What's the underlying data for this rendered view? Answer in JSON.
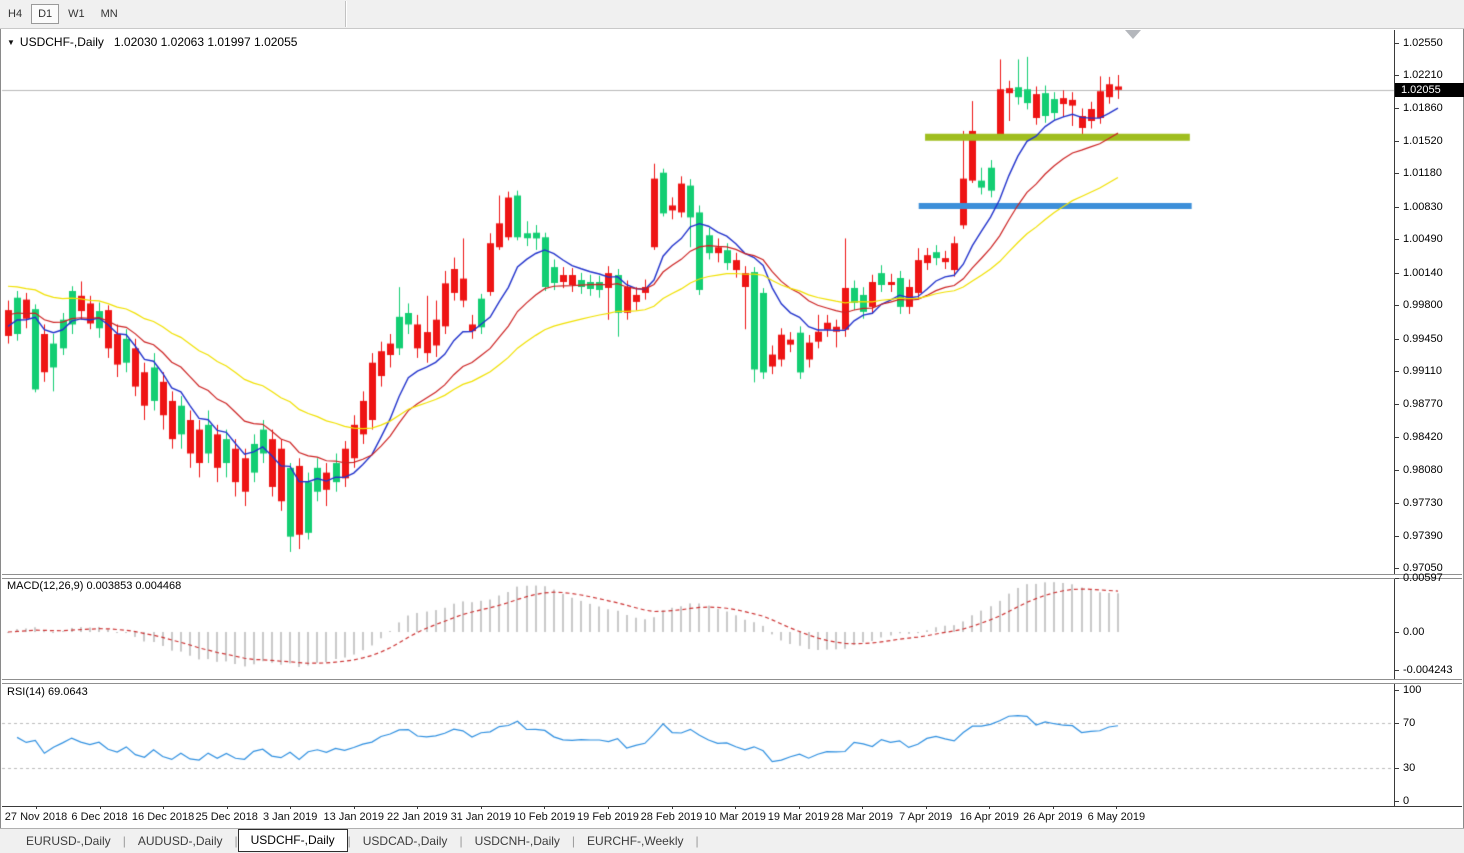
{
  "toolbar": {
    "timeframes": [
      {
        "label": "H4",
        "active": false
      },
      {
        "label": "D1",
        "active": true
      },
      {
        "label": "W1",
        "active": false
      },
      {
        "label": "MN",
        "active": false
      }
    ]
  },
  "quote": {
    "collapse_icon": "▼",
    "symbol": "USDCHF-,Daily",
    "ohlc": "1.02030 1.02063 1.01997 1.02055"
  },
  "panes": {
    "macd_label": "MACD(12,26,9) 0.003853 0.004468",
    "rsi_label": "RSI(14) 69.0643"
  },
  "price_axis": {
    "labels": [
      "1.02550",
      "1.02210",
      "1.01860",
      "1.01520",
      "1.01180",
      "1.00830",
      "1.00490",
      "1.00140",
      "0.99800",
      "0.99450",
      "0.99110",
      "0.98770",
      "0.98420",
      "0.98080",
      "0.97730",
      "0.97390",
      "0.97050"
    ],
    "current": "1.02055"
  },
  "macd_axis": [
    {
      "label": "0.00597",
      "value": 0.00597
    },
    {
      "label": "0.00",
      "value": 0
    },
    {
      "label": "-0.004243",
      "value": -0.004243
    }
  ],
  "rsi_axis": [
    {
      "label": "100",
      "value": 100
    },
    {
      "label": "70",
      "value": 70
    },
    {
      "label": "30",
      "value": 30
    },
    {
      "label": "0",
      "value": 0
    }
  ],
  "date_axis": [
    "27 Nov 2018",
    "6 Dec 2018",
    "16 Dec 2018",
    "25 Dec 2018",
    "3 Jan 2019",
    "13 Jan 2019",
    "22 Jan 2019",
    "31 Jan 2019",
    "10 Feb 2019",
    "19 Feb 2019",
    "28 Feb 2019",
    "10 Mar 2019",
    "19 Mar 2019",
    "28 Mar 2019",
    "7 Apr 2019",
    "16 Apr 2019",
    "26 Apr 2019",
    "6 May 2019"
  ],
  "tabs": [
    {
      "label": "EURUSD-,Daily",
      "active": false
    },
    {
      "label": "AUDUSD-,Daily",
      "active": false
    },
    {
      "label": "USDCHF-,Daily",
      "active": true
    },
    {
      "label": "USDCAD-,Daily",
      "active": false
    },
    {
      "label": "USDCNH-,Daily",
      "active": false
    },
    {
      "label": "EURCHF-,Weekly",
      "active": false
    }
  ],
  "tab_separator": "|",
  "colors": {
    "background": "#FFFFFF",
    "chrome": "#F0F0F0",
    "bull": "#13CE73",
    "bear": "#EE1414",
    "ma_fast": "#2233CC",
    "ma_mid": "#CC2222",
    "ma_slow": "#F0E000",
    "macd_hist": "#C9C9C9",
    "macd_signal": "#CC3333",
    "rsi_line": "#2E8FE0",
    "grid_dash": "#BBBBBB",
    "bid_line": "#B9B9B9",
    "axis_text": "#000000",
    "current_tag_bg": "#000000",
    "current_tag_text": "#FFFFFF",
    "hline_olive": "#9FBE1E",
    "hline_blue": "#3C8FD9"
  },
  "chart_data": {
    "type": "candlestick",
    "title": "USDCHF-,Daily",
    "ylim": [
      0.9701,
      1.0266
    ],
    "x_ticks": [
      "27 Nov 2018",
      "6 Dec 2018",
      "16 Dec 2018",
      "25 Dec 2018",
      "3 Jan 2019",
      "13 Jan 2019",
      "22 Jan 2019",
      "31 Jan 2019",
      "10 Feb 2019",
      "19 Feb 2019",
      "28 Feb 2019",
      "10 Mar 2019",
      "19 Mar 2019",
      "28 Mar 2019",
      "7 Apr 2019",
      "16 Apr 2019",
      "26 Apr 2019",
      "6 May 2019"
    ],
    "current_price": 1.02055,
    "last_ohlc": {
      "open": 1.0203,
      "high": 1.02063,
      "low": 1.01997,
      "close": 1.02055
    },
    "overlays": [
      {
        "type": "ema",
        "period": 8,
        "color_key": "ma_fast",
        "seed_offset": 0.001
      },
      {
        "type": "ema",
        "period": 17,
        "color_key": "ma_mid",
        "seed_offset": 0.0022
      },
      {
        "type": "ema",
        "period": 34,
        "color_key": "ma_slow",
        "seed_offset": 0.0052
      }
    ],
    "indicators": [
      {
        "type": "macd",
        "params": [
          12,
          26,
          9
        ],
        "main": 0.003853,
        "signal": 0.004468,
        "range": [
          -0.004243,
          0.00597
        ]
      },
      {
        "type": "rsi",
        "params": [
          14
        ],
        "value": 69.0643,
        "levels": [
          30,
          70
        ],
        "range": [
          0,
          100
        ]
      }
    ],
    "objects": [
      {
        "type": "hline_segment",
        "price": 1.0156,
        "from_index": 100.8,
        "to_index": 129.9,
        "color_key": "hline_olive",
        "width": 7
      },
      {
        "type": "hline_segment",
        "price": 1.0084,
        "from_index": 100.1,
        "to_index": 130.1,
        "color_key": "hline_blue",
        "width": 6
      }
    ],
    "candles": [
      [
        0.9975,
        0.9985,
        0.994,
        0.9948
      ],
      [
        0.995,
        0.9995,
        0.9943,
        0.9988
      ],
      [
        0.9986,
        0.9993,
        0.9956,
        0.9966
      ],
      [
        0.9892,
        0.9981,
        0.9889,
        0.9976
      ],
      [
        0.995,
        0.996,
        0.99,
        0.991
      ],
      [
        0.9915,
        0.995,
        0.989,
        0.994
      ],
      [
        0.9935,
        0.9972,
        0.9928,
        0.9965
      ],
      [
        0.996,
        1.0,
        0.995,
        0.9995
      ],
      [
        0.999,
        1.0005,
        0.9965,
        0.9974
      ],
      [
        0.9982,
        0.999,
        0.9955,
        0.9961
      ],
      [
        0.9956,
        0.9983,
        0.9946,
        0.9974
      ],
      [
        0.9975,
        0.998,
        0.9925,
        0.9935
      ],
      [
        0.995,
        0.996,
        0.9905,
        0.9918
      ],
      [
        0.992,
        0.9955,
        0.991,
        0.9945
      ],
      [
        0.9935,
        0.9945,
        0.9885,
        0.9895
      ],
      [
        0.991,
        0.992,
        0.986,
        0.9875
      ],
      [
        0.988,
        0.993,
        0.987,
        0.9915
      ],
      [
        0.99,
        0.991,
        0.985,
        0.9865
      ],
      [
        0.988,
        0.989,
        0.983,
        0.984
      ],
      [
        0.9845,
        0.9885,
        0.983,
        0.9875
      ],
      [
        0.986,
        0.987,
        0.981,
        0.9825
      ],
      [
        0.985,
        0.986,
        0.98,
        0.9815
      ],
      [
        0.9825,
        0.987,
        0.9815,
        0.9855
      ],
      [
        0.9845,
        0.9855,
        0.9795,
        0.981
      ],
      [
        0.9815,
        0.985,
        0.98,
        0.984
      ],
      [
        0.983,
        0.984,
        0.978,
        0.9795
      ],
      [
        0.982,
        0.983,
        0.977,
        0.9785
      ],
      [
        0.9805,
        0.9845,
        0.9795,
        0.9835
      ],
      [
        0.9825,
        0.986,
        0.9815,
        0.985
      ],
      [
        0.984,
        0.985,
        0.978,
        0.979
      ],
      [
        0.983,
        0.984,
        0.9765,
        0.9775
      ],
      [
        0.9738,
        0.9815,
        0.9722,
        0.981
      ],
      [
        0.9812,
        0.982,
        0.9725,
        0.974
      ],
      [
        0.9742,
        0.9805,
        0.9735,
        0.9795
      ],
      [
        0.9785,
        0.982,
        0.9775,
        0.981
      ],
      [
        0.9805,
        0.9815,
        0.977,
        0.9787
      ],
      [
        0.9795,
        0.9825,
        0.9785,
        0.9815
      ],
      [
        0.983,
        0.9838,
        0.979,
        0.9799
      ],
      [
        0.9855,
        0.9865,
        0.981,
        0.982
      ],
      [
        0.988,
        0.989,
        0.9835,
        0.9845
      ],
      [
        0.992,
        0.993,
        0.985,
        0.986
      ],
      [
        0.9932,
        0.9942,
        0.9895,
        0.9906
      ],
      [
        0.994,
        0.995,
        0.9915,
        0.9928
      ],
      [
        0.9935,
        0.9999,
        0.9928,
        0.9968
      ],
      [
        0.996,
        0.9982,
        0.995,
        0.9972
      ],
      [
        0.996,
        0.997,
        0.9925,
        0.9935
      ],
      [
        0.9952,
        0.999,
        0.992,
        0.993
      ],
      [
        0.9965,
        0.9985,
        0.9926,
        0.9938
      ],
      [
        1.0003,
        1.0016,
        0.995,
        0.9958
      ],
      [
        1.0018,
        1.003,
        0.9985,
        0.9993
      ],
      [
        1.0008,
        1.005,
        0.9978,
        0.9985
      ],
      [
        0.996,
        0.997,
        0.9945,
        0.9953
      ],
      [
        0.9957,
        0.9992,
        0.995,
        0.9987
      ],
      [
        1.0045,
        1.00554,
        0.999,
        0.9994
      ],
      [
        1.00658,
        1.00949,
        1.0038,
        1.00408
      ],
      [
        1.00928,
        1.0099,
        1.0048,
        1.00512
      ],
      [
        1.00512,
        1.01,
        1.0048,
        1.00949
      ],
      [
        1.00502,
        1.0068,
        1.0042,
        1.00554
      ],
      [
        1.005,
        1.0064,
        1.0038,
        1.0056
      ],
      [
        0.99992,
        1.0056,
        0.9995,
        1.00512
      ],
      [
        1.00034,
        1.0028,
        0.9996,
        1.002
      ],
      [
        1.00117,
        1.002,
        0.9998,
        1.00044
      ],
      [
        1.00117,
        1.0019,
        0.9994,
        1.00013
      ],
      [
        0.99992,
        1.0014,
        0.9992,
        1.00065
      ],
      [
        0.99971,
        1.0012,
        0.999,
        1.00044
      ],
      [
        0.99961,
        1.0011,
        0.9988,
        1.00044
      ],
      [
        1.00137,
        1.0021,
        0.99649,
        0.99982
      ],
      [
        0.99722,
        1.0018,
        0.99472,
        1.00117
      ],
      [
        0.99992,
        1.0006,
        0.9965,
        0.99722
      ],
      [
        0.99909,
        0.9999,
        0.9975,
        0.99836
      ],
      [
        0.99992,
        1.0007,
        0.9986,
        0.9993
      ],
      [
        1.01126,
        1.01282,
        1.0038,
        1.00408
      ],
      [
        1.00762,
        1.0123,
        1.0073,
        1.01188
      ],
      [
        1.00845,
        1.0093,
        1.007,
        1.00793
      ],
      [
        1.01074,
        1.0115,
        1.0072,
        1.00772
      ],
      [
        1.0072,
        1.0112,
        1.00408,
        1.01053
      ],
      [
        0.99961,
        1.00845,
        0.99909,
        1.00772
      ],
      [
        1.00346,
        1.0061,
        1.0028,
        1.00533
      ],
      [
        1.00408,
        1.005,
        1.0025,
        1.00346
      ],
      [
        1.00242,
        1.0045,
        1.0017,
        1.00377
      ],
      [
        1.00273,
        1.0035,
        1.0009,
        1.00169
      ],
      [
        1.00137,
        1.0021,
        0.9955,
        0.99992
      ],
      [
        0.99129,
        1.002,
        0.98994,
        1.00148
      ],
      [
        0.99098,
        0.9998,
        0.9903,
        0.9993
      ],
      [
        0.99285,
        0.9938,
        0.9908,
        0.9916
      ],
      [
        0.99493,
        0.9956,
        0.9916,
        0.99233
      ],
      [
        0.99441,
        0.9952,
        0.9931,
        0.99389
      ],
      [
        0.99098,
        0.9958,
        0.9903,
        0.99514
      ],
      [
        0.9941,
        0.9949,
        0.9915,
        0.99233
      ],
      [
        0.99524,
        0.99701,
        0.9935,
        0.9942
      ],
      [
        0.99618,
        0.997,
        0.9947,
        0.99545
      ],
      [
        0.99576,
        0.9965,
        0.9936,
        0.99524
      ],
      [
        0.99982,
        1.005,
        0.9947,
        0.99545
      ],
      [
        0.99826,
        1.0006,
        0.9975,
        0.99982
      ],
      [
        0.99732,
        0.9999,
        0.9966,
        0.99909
      ],
      [
        1.00044,
        1.0012,
        0.9971,
        0.99784
      ],
      [
        1.00013,
        1.0022,
        0.9994,
        1.00137
      ],
      [
        1.00044,
        1.0013,
        0.9994,
        1.00013
      ],
      [
        0.99784,
        1.0016,
        0.9971,
        1.00086
      ],
      [
        0.99992,
        1.0007,
        0.9971,
        0.99784
      ],
      [
        1.00273,
        1.00398,
        0.9986,
        0.9993
      ],
      [
        1.00325,
        1.004,
        1.0017,
        1.00242
      ],
      [
        1.00294,
        1.0043,
        1.0022,
        1.00356
      ],
      [
        1.00294,
        1.0037,
        1.0018,
        1.00252
      ],
      [
        1.0045,
        1.0052,
        1.001,
        1.00169
      ],
      [
        1.01126,
        1.01625,
        1.006,
        1.00637
      ],
      [
        1.01625,
        1.01937,
        1.0108,
        1.01105
      ],
      [
        1.01032,
        1.0124,
        1.0096,
        1.01105
      ],
      [
        1.01,
        1.0132,
        1.0093,
        1.0124
      ],
      [
        1.02061,
        1.02373,
        1.0153,
        1.01552
      ],
      [
        1.02072,
        1.0215,
        1.01729,
        1.0202
      ],
      [
        1.01978,
        1.02373,
        1.019,
        1.02082
      ],
      [
        1.01916,
        1.024,
        1.0185,
        1.02061
      ],
      [
        1.0201,
        1.0209,
        1.0169,
        1.0176
      ],
      [
        1.01781,
        1.021,
        1.0171,
        1.0202
      ],
      [
        1.01812,
        1.0203,
        1.0174,
        1.01958
      ],
      [
        1.01968,
        1.0205,
        1.0177,
        1.01906
      ],
      [
        1.0195,
        1.0203,
        1.01677,
        1.0189
      ],
      [
        1.01781,
        1.0186,
        1.01552,
        1.01656
      ],
      [
        1.01854,
        1.0193,
        1.0165,
        1.01729
      ],
      [
        1.0204,
        1.02196,
        1.017,
        1.0176
      ],
      [
        1.02113,
        1.0219,
        1.0191,
        1.01978
      ],
      [
        1.0209,
        1.0221,
        1.0196,
        1.02055
      ]
    ]
  }
}
